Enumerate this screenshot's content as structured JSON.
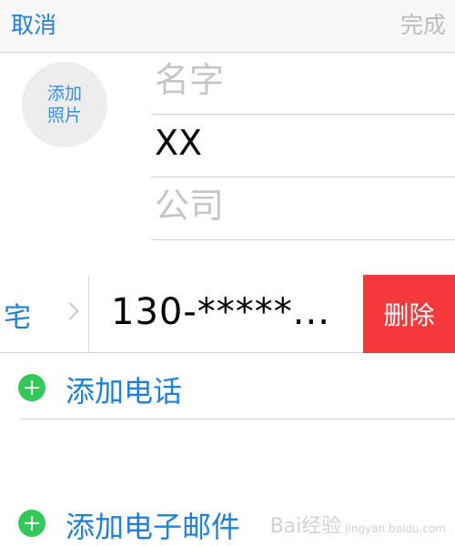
{
  "nav": {
    "cancel": "取消",
    "done": "完成"
  },
  "photo": {
    "label": "添加照片"
  },
  "name_fields": {
    "first_placeholder": "名字",
    "last_value": "XX",
    "company_placeholder": "公司"
  },
  "phone": {
    "label": "宅",
    "number": "130-*****...",
    "delete": "删除"
  },
  "actions": {
    "add_phone": "添加电话",
    "add_email": "添加电子邮件"
  },
  "watermark": {
    "text": "Bai经验",
    "sub": "jingyan.baidu.com"
  },
  "colors": {
    "accent": "#1f7fd9",
    "delete": "#f5383b",
    "add": "#35c759",
    "placeholder": "#c6c6c8"
  },
  "icons": [
    "chevron-right-icon",
    "add-circle-icon"
  ]
}
